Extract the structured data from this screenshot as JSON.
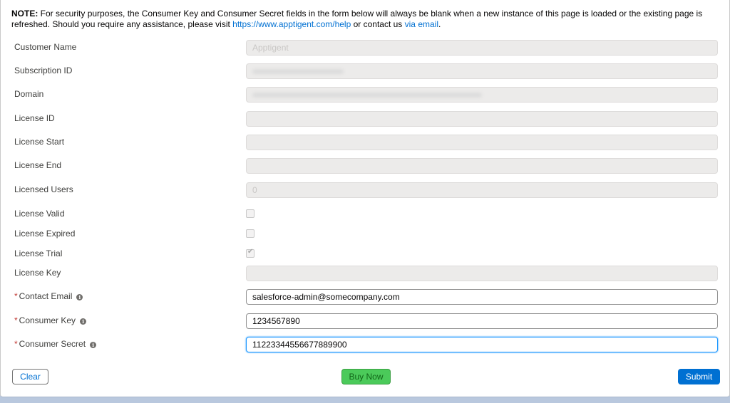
{
  "note": {
    "prefix": "NOTE:",
    "text1": " For security purposes, the Consumer Key and Consumer Secret fields in the form below will always be blank when a new instance of this page is loaded or the existing page is refreshed. Should you require any assistance, please visit ",
    "help_link": "https://www.apptigent.com/help",
    "text2": " or contact us ",
    "email_link": "via email",
    "text3": "."
  },
  "fields": {
    "customer_name": {
      "label": "Customer Name",
      "value": "Apptigent"
    },
    "subscription_id": {
      "label": "Subscription ID"
    },
    "domain": {
      "label": "Domain"
    },
    "license_id": {
      "label": "License ID",
      "value": ""
    },
    "license_start": {
      "label": "License Start",
      "value": ""
    },
    "license_end": {
      "label": "License End",
      "value": ""
    },
    "licensed_users": {
      "label": "Licensed Users",
      "value": "0"
    },
    "license_valid": {
      "label": "License Valid",
      "checked": false
    },
    "license_expired": {
      "label": "License Expired",
      "checked": false
    },
    "license_trial": {
      "label": "License Trial",
      "checked": true
    },
    "license_key": {
      "label": "License Key",
      "value": ""
    },
    "contact_email": {
      "label": "Contact Email",
      "value": "salesforce-admin@somecompany.com"
    },
    "consumer_key": {
      "label": "Consumer Key",
      "value": "1234567890"
    },
    "consumer_secret": {
      "label": "Consumer Secret",
      "value": "11223344556677889900"
    }
  },
  "required_marker": "*",
  "info_icon": "info-icon",
  "buttons": {
    "clear": "Clear",
    "buy_now": "Buy Now",
    "submit": "Submit"
  },
  "colors": {
    "link": "#0070d2",
    "required": "#c23934",
    "buy_now": "#4bca5a",
    "submit": "#0070d2"
  }
}
